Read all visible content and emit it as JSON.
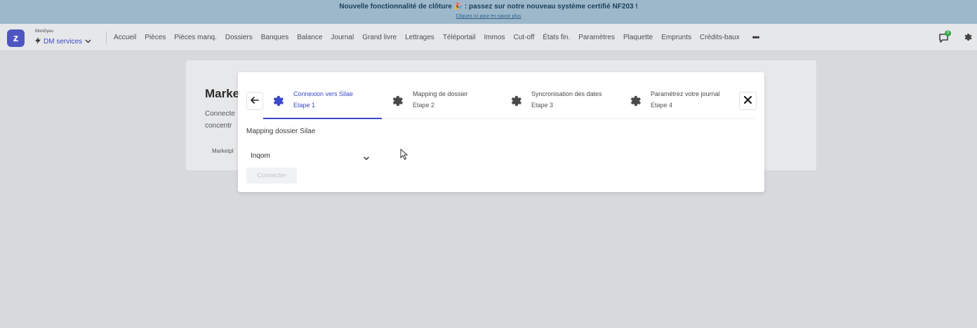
{
  "banner": {
    "title": "Nouvelle fonctionnalité de clôture 🎉 : passez sur notre nouveau système certifié NF203 !",
    "link": "Cliquez ici pour en savoir plus"
  },
  "topnav": {
    "logo_letter": "z",
    "org_caption": "MonOyeu",
    "org_name": "DM services",
    "items": [
      "Accueil",
      "Pièces",
      "Pièces manq.",
      "Dossiers",
      "Banques",
      "Balance",
      "Journal",
      "Grand livre",
      "Lettrages",
      "Téléportail",
      "Immos",
      "Cut-off",
      "États fin.",
      "Paramètres",
      "Plaquette",
      "Emprunts",
      "Crédits-baux"
    ],
    "more": "•••",
    "notification_count": "0"
  },
  "background_page": {
    "title": "Marke",
    "desc_line1": "Connecte",
    "desc_line2": "concentr",
    "tab": "Marketpl"
  },
  "modal": {
    "steps": [
      {
        "title": "Connexion vers Silae",
        "subtitle": "Etape 1",
        "active": true
      },
      {
        "title": "Mapping de dossier",
        "subtitle": "Etape 2",
        "active": false
      },
      {
        "title": "Syncronisation des dates",
        "subtitle": "Etape 3",
        "active": false
      },
      {
        "title": "Paramétrez votre journal",
        "subtitle": "Etape 4",
        "active": false
      }
    ],
    "section_label": "Mapping dossier Silae",
    "select_value": "Inqom",
    "connect_label": "Connecter"
  },
  "colors": {
    "accent": "#3b48c9",
    "banner_bg": "#9db8cb",
    "overlay_bg": "#d7d9dc",
    "badge": "#3aa64a"
  },
  "icons": [
    "logo-icon",
    "bolt-icon",
    "chevron-down-icon",
    "more-icon",
    "chat-icon",
    "settings-icon",
    "arrow-left-icon",
    "gear-icon",
    "close-icon",
    "mouse-cursor-icon"
  ]
}
